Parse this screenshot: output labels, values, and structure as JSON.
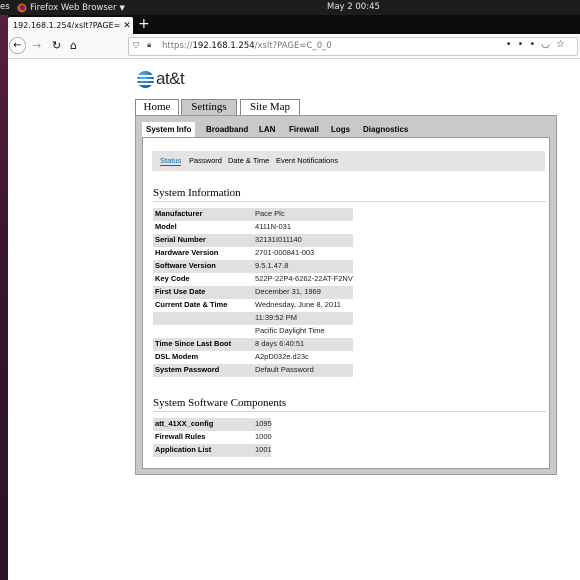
{
  "system_bar": {
    "activities": "es",
    "app_name": "Firefox Web Browser",
    "clock": "May 2  00:45"
  },
  "browser": {
    "tab_title": "192.168.1.254/xslt?PAGE=C",
    "url_prefix": "https://",
    "url_host": "192.168.1.254",
    "url_path": "/xslt?PAGE=C_0_0"
  },
  "page": {
    "logo_text": "at&t",
    "main_tabs": [
      {
        "label": "Home"
      },
      {
        "label": "Settings"
      },
      {
        "label": "Site Map"
      }
    ],
    "sub_tabs": [
      {
        "label": "System Info"
      },
      {
        "label": "Broadband"
      },
      {
        "label": "LAN"
      },
      {
        "label": "Firewall"
      },
      {
        "label": "Logs"
      },
      {
        "label": "Diagnostics"
      }
    ],
    "sub_links": [
      {
        "label": "Status"
      },
      {
        "label": "Password"
      },
      {
        "label": "Date & Time"
      },
      {
        "label": "Event Notifications"
      }
    ],
    "system_info": {
      "title": "System Information",
      "rows": [
        {
          "key": "Manufacturer",
          "value": "Pace Plc"
        },
        {
          "key": "Model",
          "value": "4111N-031"
        },
        {
          "key": "Serial Number",
          "value": "32131I011140"
        },
        {
          "key": "Hardware Version",
          "value": "2701-000841-003"
        },
        {
          "key": "Software Version",
          "value": "9.5.1.47.8"
        },
        {
          "key": "Key Code",
          "value": "522P-22P4-6262-22AT-F2NV"
        },
        {
          "key": "First Use Date",
          "value": "December 31, 1969"
        },
        {
          "key": "Current Date & Time",
          "value": "Wednesday, June 8, 2011"
        },
        {
          "key": "",
          "value": "11:39:52 PM"
        },
        {
          "key": "",
          "value": "Pacific Daylight Time"
        },
        {
          "key": "Time Since Last Boot",
          "value": "8 days 6:40:51"
        },
        {
          "key": "DSL Modem",
          "value": "A2pD032e.d23c"
        },
        {
          "key": "System Password",
          "value": "Default Password"
        }
      ]
    },
    "components": {
      "title": "System Software Components",
      "rows": [
        {
          "key": "att_41XX_config",
          "value": "1095"
        },
        {
          "key": "Firewall Rules",
          "value": "1000"
        },
        {
          "key": "Application List",
          "value": "1001"
        }
      ]
    }
  }
}
